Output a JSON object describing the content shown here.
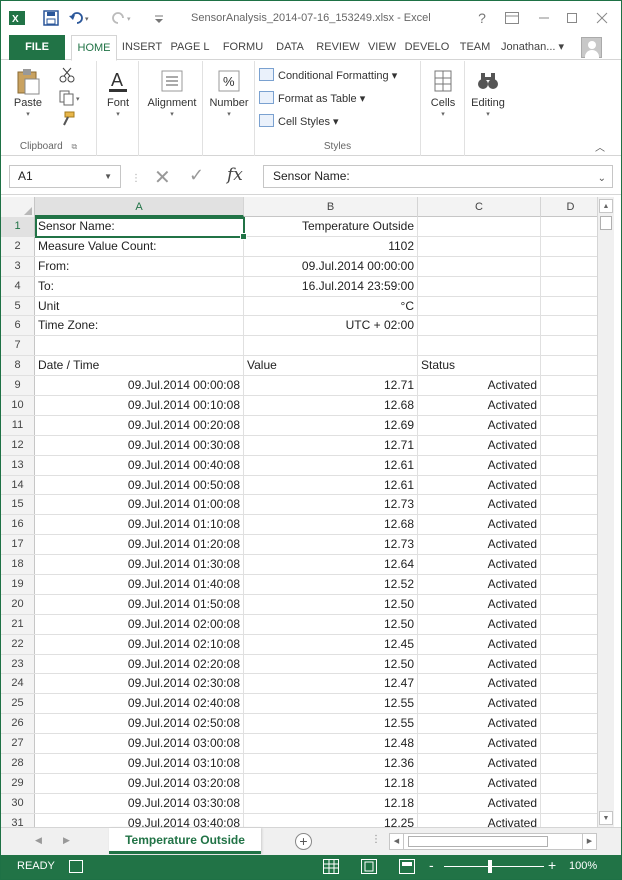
{
  "window": {
    "title": "SensorAnalysis_2014-07-16_153249.xlsx - Excel",
    "help": "?",
    "user_name": "Jonathan... ▾"
  },
  "ribbon": {
    "tabs": [
      "FILE",
      "HOME",
      "INSERT",
      "PAGE L",
      "FORMU",
      "DATA",
      "REVIEW",
      "VIEW",
      "DEVELO",
      "TEAM"
    ],
    "active_tab": "HOME",
    "clipboard": {
      "paste": "Paste",
      "label": "Clipboard"
    },
    "font_label": "Font",
    "alignment_label": "Alignment",
    "number_label": "Number",
    "styles": {
      "conditional": "Conditional Formatting ▾",
      "format_table": "Format as Table ▾",
      "cell_styles": "Cell Styles ▾",
      "label": "Styles"
    },
    "cells_label": "Cells",
    "editing_label": "Editing"
  },
  "formula_bar": {
    "name_box": "A1",
    "fx": "fx",
    "value": "Sensor Name:"
  },
  "columns": [
    "A",
    "B",
    "C",
    "D"
  ],
  "selected_cell": "A1",
  "rows": [
    {
      "n": "1",
      "a": "Sensor Name:",
      "b": "Temperature Outside",
      "c": ""
    },
    {
      "n": "2",
      "a": "Measure Value Count:",
      "b": "1102",
      "c": ""
    },
    {
      "n": "3",
      "a": "From:",
      "b": "09.Jul.2014 00:00:00",
      "c": ""
    },
    {
      "n": "4",
      "a": "To:",
      "b": "16.Jul.2014 23:59:00",
      "c": ""
    },
    {
      "n": "5",
      "a": "Unit",
      "b": "°C",
      "c": ""
    },
    {
      "n": "6",
      "a": "Time Zone:",
      "b": "UTC + 02:00",
      "c": ""
    },
    {
      "n": "7",
      "a": "",
      "b": "",
      "c": ""
    },
    {
      "n": "8",
      "a": "Date / Time",
      "b": "Value",
      "c": "Status"
    },
    {
      "n": "9",
      "a": "09.Jul.2014 00:00:08",
      "b": "12.71",
      "c": "Activated"
    },
    {
      "n": "10",
      "a": "09.Jul.2014 00:10:08",
      "b": "12.68",
      "c": "Activated"
    },
    {
      "n": "11",
      "a": "09.Jul.2014 00:20:08",
      "b": "12.69",
      "c": "Activated"
    },
    {
      "n": "12",
      "a": "09.Jul.2014 00:30:08",
      "b": "12.71",
      "c": "Activated"
    },
    {
      "n": "13",
      "a": "09.Jul.2014 00:40:08",
      "b": "12.61",
      "c": "Activated"
    },
    {
      "n": "14",
      "a": "09.Jul.2014 00:50:08",
      "b": "12.61",
      "c": "Activated"
    },
    {
      "n": "15",
      "a": "09.Jul.2014 01:00:08",
      "b": "12.73",
      "c": "Activated"
    },
    {
      "n": "16",
      "a": "09.Jul.2014 01:10:08",
      "b": "12.68",
      "c": "Activated"
    },
    {
      "n": "17",
      "a": "09.Jul.2014 01:20:08",
      "b": "12.73",
      "c": "Activated"
    },
    {
      "n": "18",
      "a": "09.Jul.2014 01:30:08",
      "b": "12.64",
      "c": "Activated"
    },
    {
      "n": "19",
      "a": "09.Jul.2014 01:40:08",
      "b": "12.52",
      "c": "Activated"
    },
    {
      "n": "20",
      "a": "09.Jul.2014 01:50:08",
      "b": "12.50",
      "c": "Activated"
    },
    {
      "n": "21",
      "a": "09.Jul.2014 02:00:08",
      "b": "12.50",
      "c": "Activated"
    },
    {
      "n": "22",
      "a": "09.Jul.2014 02:10:08",
      "b": "12.45",
      "c": "Activated"
    },
    {
      "n": "23",
      "a": "09.Jul.2014 02:20:08",
      "b": "12.50",
      "c": "Activated"
    },
    {
      "n": "24",
      "a": "09.Jul.2014 02:30:08",
      "b": "12.47",
      "c": "Activated"
    },
    {
      "n": "25",
      "a": "09.Jul.2014 02:40:08",
      "b": "12.55",
      "c": "Activated"
    },
    {
      "n": "26",
      "a": "09.Jul.2014 02:50:08",
      "b": "12.55",
      "c": "Activated"
    },
    {
      "n": "27",
      "a": "09.Jul.2014 03:00:08",
      "b": "12.48",
      "c": "Activated"
    },
    {
      "n": "28",
      "a": "09.Jul.2014 03:10:08",
      "b": "12.36",
      "c": "Activated"
    },
    {
      "n": "29",
      "a": "09.Jul.2014 03:20:08",
      "b": "12.18",
      "c": "Activated"
    },
    {
      "n": "30",
      "a": "09.Jul.2014 03:30:08",
      "b": "12.18",
      "c": "Activated"
    },
    {
      "n": "31",
      "a": "09.Jul.2014 03:40:08",
      "b": "12.25",
      "c": "Activated"
    }
  ],
  "sheet_tab": "Temperature Outside",
  "status_bar": {
    "status": "READY",
    "zoom": "100%",
    "zoom_minus": "-",
    "zoom_plus": "+"
  },
  "colors": {
    "accent": "#217346"
  }
}
